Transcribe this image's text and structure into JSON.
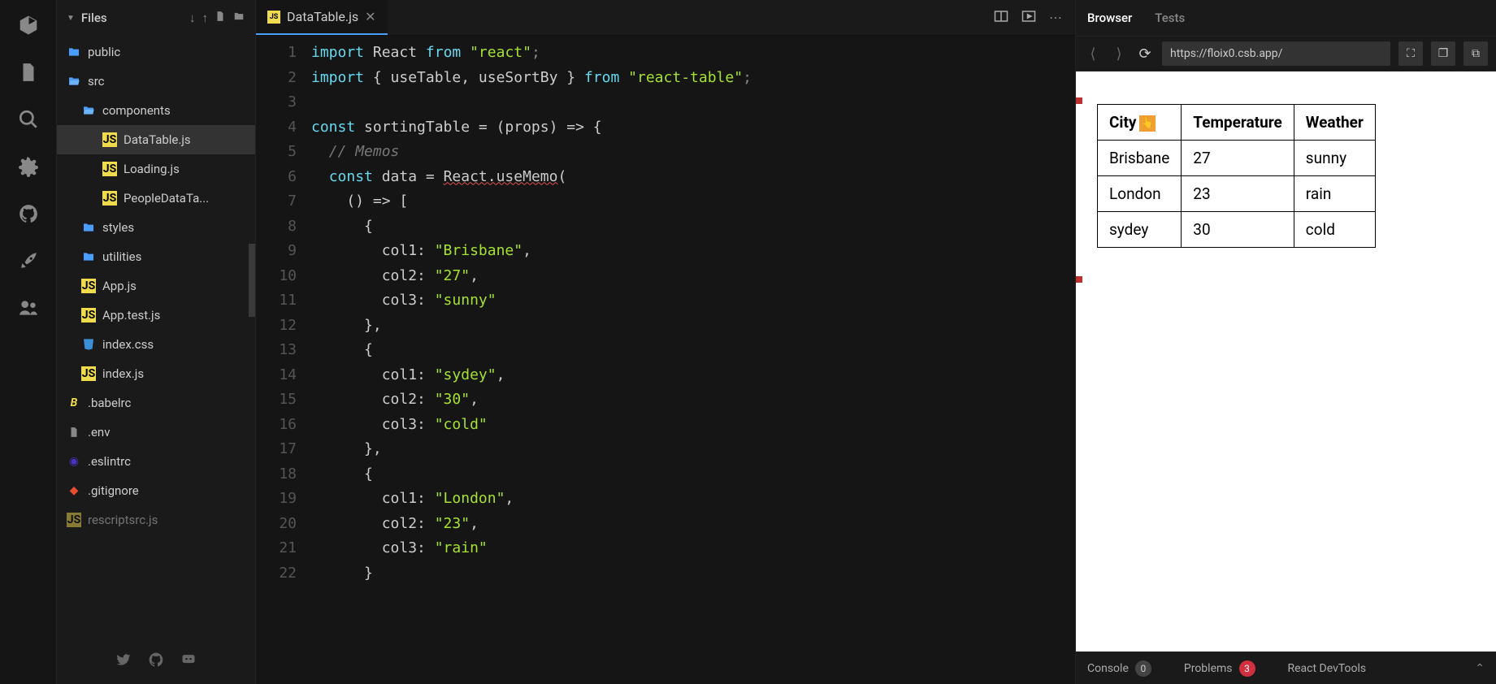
{
  "sidebar": {
    "title": "Files",
    "tree": [
      {
        "name": "public",
        "type": "folder",
        "depth": 0
      },
      {
        "name": "src",
        "type": "folder-open",
        "depth": 0
      },
      {
        "name": "components",
        "type": "folder-open",
        "depth": 1
      },
      {
        "name": "DataTable.js",
        "type": "js",
        "depth": 2,
        "active": true
      },
      {
        "name": "Loading.js",
        "type": "js",
        "depth": 2
      },
      {
        "name": "PeopleDataTa...",
        "type": "js",
        "depth": 2
      },
      {
        "name": "styles",
        "type": "folder",
        "depth": 1
      },
      {
        "name": "utilities",
        "type": "folder",
        "depth": 1
      },
      {
        "name": "App.js",
        "type": "js",
        "depth": 1
      },
      {
        "name": "App.test.js",
        "type": "js",
        "depth": 1
      },
      {
        "name": "index.css",
        "type": "css",
        "depth": 1
      },
      {
        "name": "index.js",
        "type": "js",
        "depth": 1
      },
      {
        "name": ".babelrc",
        "type": "babel",
        "depth": 0
      },
      {
        "name": ".env",
        "type": "file",
        "depth": 0
      },
      {
        "name": ".eslintrc",
        "type": "eslint",
        "depth": 0
      },
      {
        "name": ".gitignore",
        "type": "git",
        "depth": 0
      },
      {
        "name": "rescriptsrc.js",
        "type": "js",
        "depth": 0,
        "dim": true
      }
    ]
  },
  "editor": {
    "active_tab": "DataTable.js",
    "tab_icon": "JS",
    "lines": [
      {
        "n": 1,
        "seg": [
          [
            "import",
            "kw"
          ],
          [
            " React ",
            "ident"
          ],
          [
            "from",
            "kw"
          ],
          [
            " ",
            "ident"
          ],
          [
            "\"react\"",
            "str2"
          ],
          [
            ";",
            "punc"
          ]
        ]
      },
      {
        "n": 2,
        "seg": [
          [
            "import",
            "kw"
          ],
          [
            " { useTable, useSortBy } ",
            "ident"
          ],
          [
            "from",
            "kw"
          ],
          [
            " ",
            "ident"
          ],
          [
            "\"react-table\"",
            "str2"
          ],
          [
            ";",
            "punc"
          ]
        ]
      },
      {
        "n": 3,
        "seg": []
      },
      {
        "n": 4,
        "seg": [
          [
            "const",
            "kw"
          ],
          [
            " sortingTable = (props) => {",
            "ident"
          ]
        ]
      },
      {
        "n": 5,
        "seg": [
          [
            "  ",
            "ident"
          ],
          [
            "// Memos",
            "comment"
          ]
        ]
      },
      {
        "n": 6,
        "seg": [
          [
            "  ",
            "ident"
          ],
          [
            "const",
            "kw"
          ],
          [
            " data = ",
            "ident"
          ],
          [
            "React.useMemo",
            "underline"
          ],
          [
            "(",
            "ident"
          ]
        ]
      },
      {
        "n": 7,
        "seg": [
          [
            "    () => [",
            "ident"
          ]
        ]
      },
      {
        "n": 8,
        "seg": [
          [
            "      {",
            "ident"
          ]
        ]
      },
      {
        "n": 9,
        "seg": [
          [
            "        col1: ",
            "ident"
          ],
          [
            "\"Brisbane\"",
            "str2"
          ],
          [
            ",",
            "ident"
          ]
        ]
      },
      {
        "n": 10,
        "seg": [
          [
            "        col2: ",
            "ident"
          ],
          [
            "\"27\"",
            "str2"
          ],
          [
            ",",
            "ident"
          ]
        ]
      },
      {
        "n": 11,
        "seg": [
          [
            "        col3: ",
            "ident"
          ],
          [
            "\"sunny\"",
            "str2"
          ]
        ]
      },
      {
        "n": 12,
        "seg": [
          [
            "      },",
            "ident"
          ]
        ]
      },
      {
        "n": 13,
        "seg": [
          [
            "      {",
            "ident"
          ]
        ]
      },
      {
        "n": 14,
        "seg": [
          [
            "        col1: ",
            "ident"
          ],
          [
            "\"sydey\"",
            "str2"
          ],
          [
            ",",
            "ident"
          ]
        ]
      },
      {
        "n": 15,
        "seg": [
          [
            "        col2: ",
            "ident"
          ],
          [
            "\"30\"",
            "str2"
          ],
          [
            ",",
            "ident"
          ]
        ]
      },
      {
        "n": 16,
        "seg": [
          [
            "        col3: ",
            "ident"
          ],
          [
            "\"cold\"",
            "str2"
          ]
        ]
      },
      {
        "n": 17,
        "seg": [
          [
            "      },",
            "ident"
          ]
        ]
      },
      {
        "n": 18,
        "seg": [
          [
            "      {",
            "ident"
          ]
        ]
      },
      {
        "n": 19,
        "seg": [
          [
            "        col1: ",
            "ident"
          ],
          [
            "\"London\"",
            "str2"
          ],
          [
            ",",
            "ident"
          ]
        ]
      },
      {
        "n": 20,
        "seg": [
          [
            "        col2: ",
            "ident"
          ],
          [
            "\"23\"",
            "str2"
          ],
          [
            ",",
            "ident"
          ]
        ]
      },
      {
        "n": 21,
        "seg": [
          [
            "        col3: ",
            "ident"
          ],
          [
            "\"rain\"",
            "str2"
          ]
        ]
      },
      {
        "n": 22,
        "seg": [
          [
            "      }",
            "ident"
          ]
        ]
      }
    ]
  },
  "preview": {
    "tabs": [
      "Browser",
      "Tests"
    ],
    "active_tab": "Browser",
    "url": "https://floix0.csb.app/",
    "table": {
      "columns": [
        "City",
        "Temperature",
        "Weather"
      ],
      "sorted_col_index": 0,
      "rows": [
        [
          "Brisbane",
          "27",
          "sunny"
        ],
        [
          "London",
          "23",
          "rain"
        ],
        [
          "sydey",
          "30",
          "cold"
        ]
      ]
    },
    "bottom": {
      "console_label": "Console",
      "console_count": "0",
      "problems_label": "Problems",
      "problems_count": "3",
      "devtools_label": "React DevTools"
    }
  }
}
